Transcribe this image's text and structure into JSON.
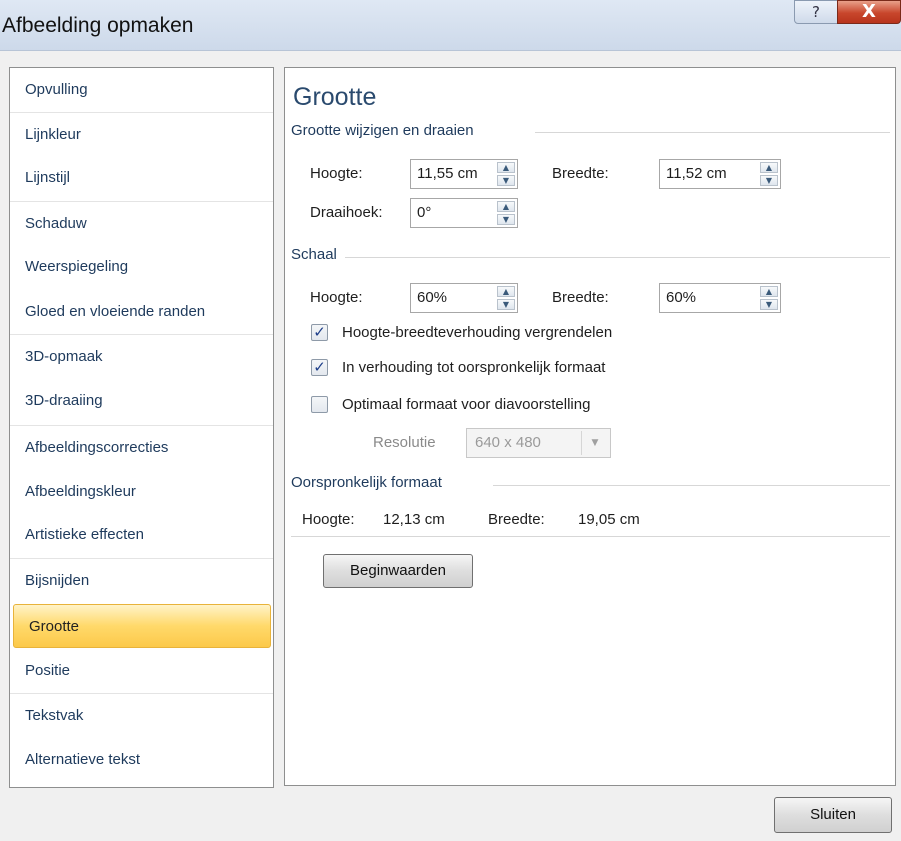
{
  "window": {
    "title": "Afbeelding opmaken",
    "help_icon": "?",
    "close_icon": "X"
  },
  "sidebar": {
    "items": [
      {
        "label": "Opvulling"
      },
      {
        "label": "Lijnkleur"
      },
      {
        "label": "Lijnstijl"
      },
      {
        "label": "Schaduw"
      },
      {
        "label": "Weerspiegeling"
      },
      {
        "label": "Gloed en vloeiende randen"
      },
      {
        "label": "3D-opmaak"
      },
      {
        "label": "3D-draaiing"
      },
      {
        "label": "Afbeeldingscorrecties"
      },
      {
        "label": "Afbeeldingskleur"
      },
      {
        "label": "Artistieke effecten"
      },
      {
        "label": "Bijsnijden"
      },
      {
        "label": "Grootte"
      },
      {
        "label": "Positie"
      },
      {
        "label": "Tekstvak"
      },
      {
        "label": "Alternatieve tekst"
      }
    ],
    "selected": "Grootte",
    "selected_color": "#ffd96a"
  },
  "panel": {
    "heading": "Grootte",
    "resize_section": {
      "title": "Grootte wijzigen en draaien",
      "height_label": "Hoogte:",
      "height_value": "11,55 cm",
      "width_label": "Breedte:",
      "width_value": "11,52 cm",
      "rotation_label": "Draaihoek:",
      "rotation_value": "0°"
    },
    "scale_section": {
      "title": "Schaal",
      "height_label": "Hoogte:",
      "height_value": "60%",
      "width_label": "Breedte:",
      "width_value": "60%",
      "lock_aspect_label": "Hoogte-breedteverhouding vergrendelen",
      "lock_aspect_checked": true,
      "relative_original_label": "In verhouding tot oorspronkelijk formaat",
      "relative_original_checked": true,
      "best_scale_label": "Optimaal formaat voor diavoorstelling",
      "best_scale_checked": false,
      "resolution_label": "Resolutie",
      "resolution_value": "640 x 480"
    },
    "original_section": {
      "title": "Oorspronkelijk formaat",
      "height_label": "Hoogte:",
      "height_value": "12,13 cm",
      "width_label": "Breedte:",
      "width_value": "19,05 cm"
    },
    "reset_button": "Beginwaarden"
  },
  "footer": {
    "close_button": "Sluiten"
  },
  "icons": {
    "spin_up": "▲",
    "spin_down": "▼",
    "dropdown": "▼",
    "check": "✓"
  }
}
